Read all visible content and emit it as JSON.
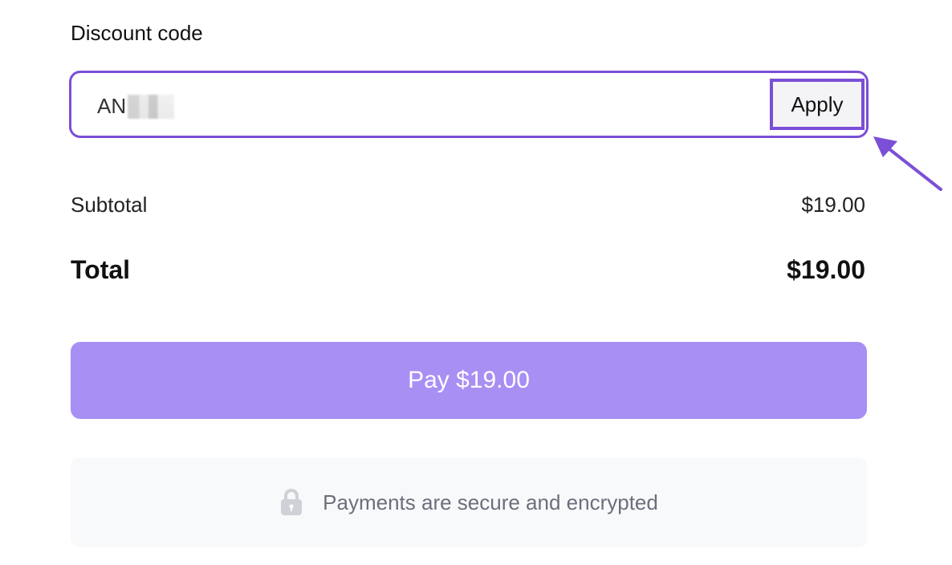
{
  "discount": {
    "label": "Discount code",
    "value": "AN",
    "apply_label": "Apply"
  },
  "summary": {
    "subtotal_label": "Subtotal",
    "subtotal_value": "$19.00",
    "total_label": "Total",
    "total_value": "$19.00"
  },
  "pay": {
    "label": "Pay $19.00"
  },
  "secure": {
    "text": "Payments are secure and encrypted",
    "icon": "lock-icon"
  },
  "annotation": {
    "icon": "arrow-icon",
    "color": "#7b4fd6"
  },
  "colors": {
    "accent": "#7b4fd6",
    "pay_button": "#a88ff3"
  }
}
